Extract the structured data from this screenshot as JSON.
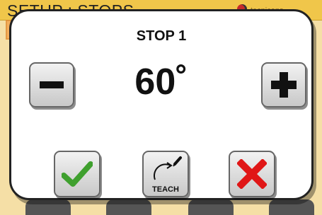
{
  "background": {
    "header_title": "SETUP : STOPS",
    "brand": "tecnicans"
  },
  "dialog": {
    "title": "STOP 1",
    "value": "60˚",
    "teach_label": "TEACH"
  },
  "icons": {
    "minus": "minus-icon",
    "plus": "plus-icon",
    "ok": "checkmark-icon",
    "teach": "teach-arc-pen-icon",
    "cancel": "x-icon"
  },
  "colors": {
    "header_bg": "#f0c64a",
    "dialog_bg": "#ffffff",
    "ok_green": "#3fa02e",
    "cancel_red": "#e01616"
  }
}
